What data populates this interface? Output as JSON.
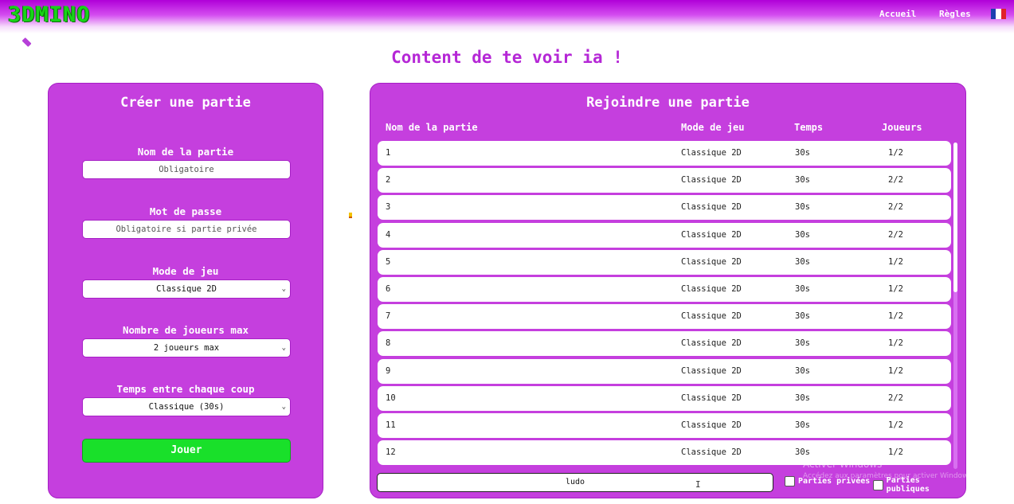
{
  "header": {
    "logo": "3DMINO",
    "nav": [
      {
        "label": "Accueil"
      },
      {
        "label": "Règles"
      }
    ],
    "language_icon": "france-flag-icon"
  },
  "welcome": "Content de te voir ia !",
  "create": {
    "title": "Créer une partie",
    "fields": [
      {
        "label": "Nom de la partie",
        "placeholder": "Obligatoire",
        "type": "text"
      },
      {
        "label": "Mot de passe",
        "placeholder": "Obligatoire si partie privée",
        "type": "text"
      },
      {
        "label": "Mode de jeu",
        "value": "Classique 2D",
        "type": "select"
      },
      {
        "label": "Nombre de joueurs max",
        "value": "2 joueurs max",
        "type": "select"
      },
      {
        "label": "Temps entre chaque coup",
        "value": "Classique (30s)",
        "type": "select"
      }
    ],
    "play_label": "Jouer"
  },
  "join": {
    "title": "Rejoindre une partie",
    "columns": [
      "Nom de la partie",
      "Mode de jeu",
      "Temps",
      "Joueurs"
    ],
    "rows": [
      {
        "name": "1",
        "mode": "Classique 2D",
        "time": "30s",
        "players": "1/2"
      },
      {
        "name": "2",
        "mode": "Classique 2D",
        "time": "30s",
        "players": "2/2"
      },
      {
        "name": "3",
        "mode": "Classique 2D",
        "time": "30s",
        "players": "2/2"
      },
      {
        "name": "4",
        "mode": "Classique 2D",
        "time": "30s",
        "players": "2/2"
      },
      {
        "name": "5",
        "mode": "Classique 2D",
        "time": "30s",
        "players": "1/2"
      },
      {
        "name": "6",
        "mode": "Classique 2D",
        "time": "30s",
        "players": "1/2"
      },
      {
        "name": "7",
        "mode": "Classique 2D",
        "time": "30s",
        "players": "1/2"
      },
      {
        "name": "8",
        "mode": "Classique 2D",
        "time": "30s",
        "players": "1/2"
      },
      {
        "name": "9",
        "mode": "Classique 2D",
        "time": "30s",
        "players": "1/2"
      },
      {
        "name": "10",
        "mode": "Classique 2D",
        "time": "30s",
        "players": "2/2"
      },
      {
        "name": "11",
        "mode": "Classique 2D",
        "time": "30s",
        "players": "1/2"
      },
      {
        "name": "12",
        "mode": "Classique 2D",
        "time": "30s",
        "players": "1/2"
      }
    ],
    "search_value": "ludo",
    "filter_private": "Parties privées",
    "filter_public": "Parties publiques"
  },
  "watermark": {
    "line1": "Activer Windows",
    "line2": "Accédez aux paramètres pour activer Windows."
  },
  "colors": {
    "panel": "#c53fde",
    "accent": "#b527d6",
    "play": "#19e02a",
    "logo": "#18d418"
  }
}
